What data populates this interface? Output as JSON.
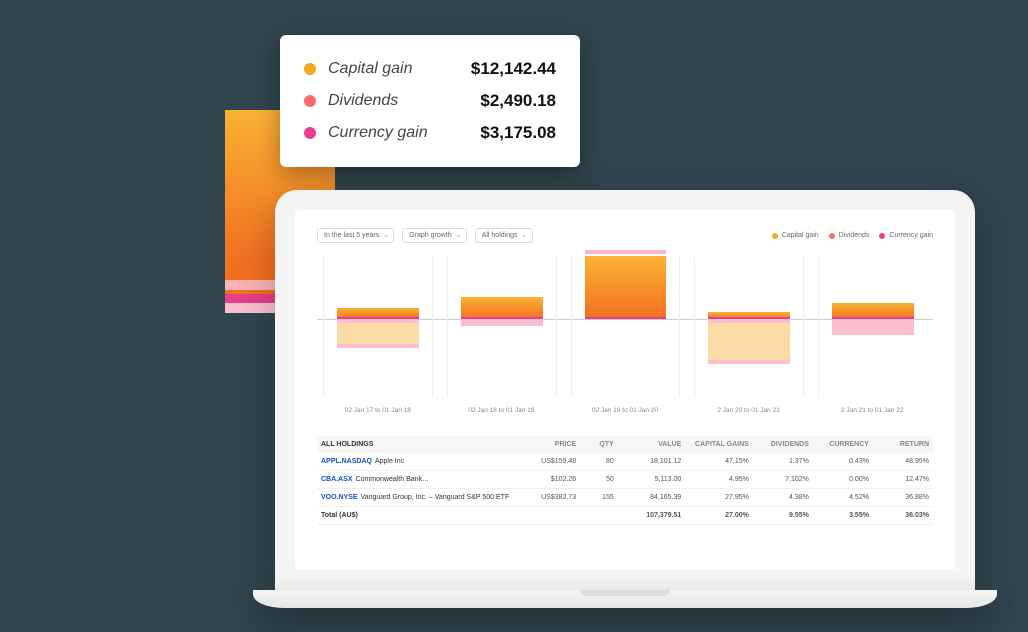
{
  "tooltip": {
    "capital_gain_label": "Capital gain",
    "capital_gain_value": "$12,142.44",
    "dividends_label": "Dividends",
    "dividends_value": "$2,490.18",
    "currency_gain_label": "Currency gain",
    "currency_gain_value": "$3,175.08"
  },
  "colors": {
    "capital": "#f5a623",
    "dividends": "#ff6b6b",
    "currency": "#e83e8c"
  },
  "filters": {
    "range": "In the last 5 years",
    "plot": "Graph growth",
    "grouping": "All holdings"
  },
  "legend": {
    "capital": "Capital gain",
    "dividends": "Dividends",
    "currency": "Currency gain"
  },
  "chart_data": {
    "type": "bar",
    "title": "",
    "xlabel": "",
    "ylabel": "",
    "ylim": [
      -60,
      80
    ],
    "zero_at": 62,
    "categories": [
      "02 Jan 17 to 01 Jan 18",
      "02 Jan 18 to 01 Jan 19",
      "02 Jan 19 to 01 Jan 20",
      "2 Jan 20 to 01 Jan 21",
      "2 Jan 21 to 01 Jan 22"
    ],
    "series": [
      {
        "name": "Capital gain",
        "key": "cap",
        "values": [
          12,
          25,
          70,
          8,
          18
        ]
      },
      {
        "name": "Dividends",
        "key": "div",
        "values": [
          -32,
          -8,
          5,
          -50,
          -18
        ]
      },
      {
        "name": "Currency gain",
        "key": "cur",
        "values": [
          3,
          3,
          4,
          3,
          3
        ]
      }
    ]
  },
  "table": {
    "headers": {
      "name": "ALL HOLDINGS",
      "price": "PRICE",
      "qty": "QTY",
      "value": "VALUE",
      "capital_gains": "CAPITAL GAINS",
      "dividends": "DIVIDENDS",
      "currency": "CURRENCY",
      "return": "RETURN"
    },
    "rows": [
      {
        "sym": "APPL.NASDAQ",
        "name": "Apple Inc",
        "price": "US$159.48",
        "qty": "80",
        "value": "18,101.12",
        "cg": "47.15%",
        "div": "1.37%",
        "cur": "0.43%",
        "ret": "48.95%"
      },
      {
        "sym": "CBA.ASX",
        "name": "Commonwealth Bank…",
        "price": "$102.26",
        "qty": "50",
        "value": "5,113.00",
        "cg": "4.95%",
        "div": "7.102%",
        "cur": "0.00%",
        "ret": "12.47%"
      },
      {
        "sym": "VOO.NYSE",
        "name": "Vanguard Group, Inc. – Vanguard S&P 500 ETF",
        "price": "US$382.73",
        "qty": "155",
        "value": "84,165.39",
        "cg": "27.95%",
        "div": "4.38%",
        "cur": "4.52%",
        "ret": "36.88%"
      }
    ],
    "total": {
      "label": "Total (AU$)",
      "value": "107,379.51",
      "cg": "27.00%",
      "div": "9.55%",
      "cur": "3.55%",
      "ret": "36.03%"
    }
  }
}
